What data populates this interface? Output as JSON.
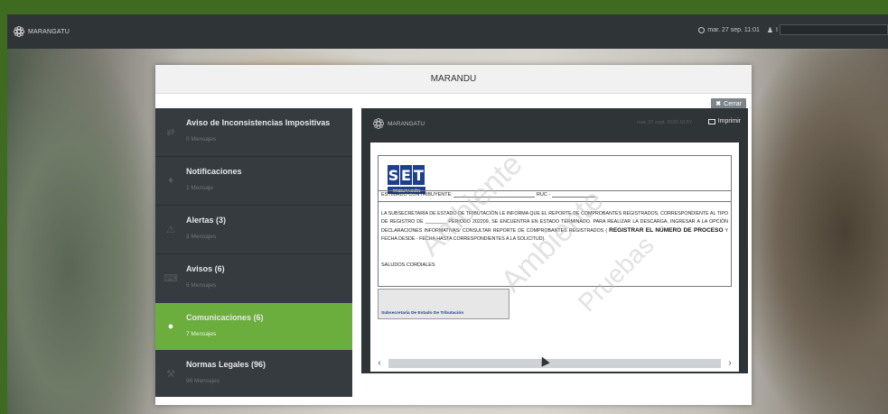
{
  "app": {
    "name": "MARANGATU"
  },
  "topbar": {
    "datetime": "mar. 27 sep. 11:01",
    "user_initial": "I"
  },
  "modal": {
    "title": "MARANDU",
    "close_label": "Cerrar"
  },
  "sidebar": {
    "items": [
      {
        "title": "Aviso de Inconsistencias Impositivas",
        "sub": "0 Mensajes",
        "icon": "shuffle-icon",
        "active": false
      },
      {
        "title": "Notificaciones",
        "sub": "1 Mensaje",
        "icon": "bell-icon",
        "active": false
      },
      {
        "title": "Alertas (3)",
        "sub": "3 Mensajes",
        "icon": "warning-icon",
        "active": false
      },
      {
        "title": "Avisos (6)",
        "sub": "6 Mensajes",
        "icon": "keyboard-icon",
        "active": false
      },
      {
        "title": "Comunicaciones (6)",
        "sub": "7 Mensajes",
        "icon": "chat-icon",
        "active": true
      },
      {
        "title": "Normas Legales (96)",
        "sub": "96 Mensajes",
        "icon": "gavel-icon",
        "active": false
      }
    ]
  },
  "message": {
    "brand": "MARANGATU",
    "date": "mar. 27 sept. 2022 10:57",
    "print_label": "Imprimir",
    "set_letters": [
      "S",
      "E",
      "T"
    ],
    "set_subtitle": "TRIBUTACIÓN",
    "dear_label": "ESTIMADO CONTRIBUYENTE:",
    "ruc_label": "RUC -",
    "body_1": "LA SUBSECRETARÍA DE ESTADO DE TRIBUTACIÓN LE INFORMA QUE EL REPORTE DE COMPROBANTES REGISTRADOS, CORRESPONDIENTE AL TIPO DE REGISTRO DE ________ PERIODO 202209, SE ENCUENTRA EN ESTADO TERMINADO. PARA REALIZAR LA DESCARGA, INGRESAR A LA OPCIÓN DECLARACIONES INFORMATIVAS/ CONSULTAR REPORTE DE COMPROBANTES REGISTRADOS ( ",
    "body_bold": "REGISTRAR EL NÚMERO DE PROCESO",
    "body_2": " Y FECHA DESDE - FECHA HASTA CORRESPONDIENTES A LA SOLICITUD).",
    "regards": "SALUDOS CORDIALES",
    "signature": "Subsecretaría De Estado De Tributación",
    "watermarks": [
      "Ambiente",
      "de",
      "Pruebas"
    ]
  }
}
